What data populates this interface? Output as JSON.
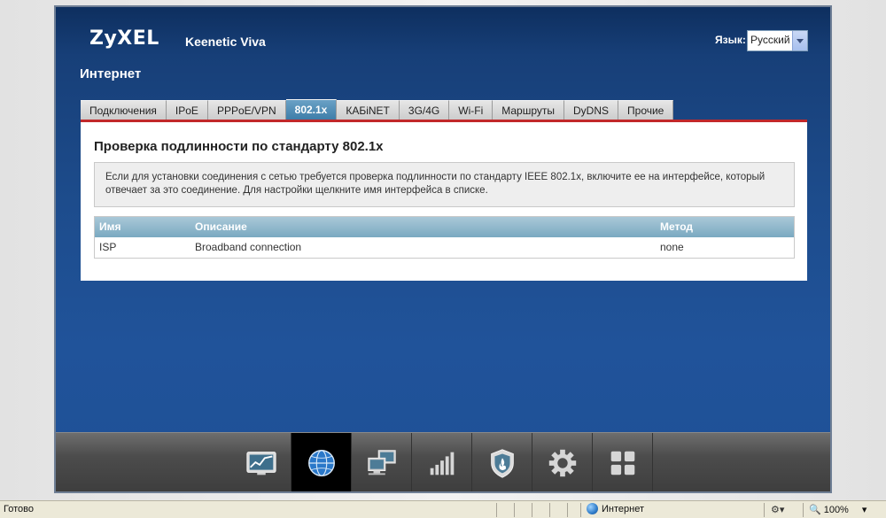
{
  "header": {
    "logo": "ZyXEL",
    "model": "Keenetic Viva",
    "language_label": "Язык:",
    "language_value": "Русский"
  },
  "section_title": "Интернет",
  "tabs": [
    {
      "label": "Подключения",
      "active": false
    },
    {
      "label": "IPoE",
      "active": false
    },
    {
      "label": "PPPoE/VPN",
      "active": false
    },
    {
      "label": "802.1x",
      "active": true
    },
    {
      "label": "КАБiNET",
      "active": false
    },
    {
      "label": "3G/4G",
      "active": false
    },
    {
      "label": "Wi-Fi",
      "active": false
    },
    {
      "label": "Маршруты",
      "active": false
    },
    {
      "label": "DyDNS",
      "active": false
    },
    {
      "label": "Прочие",
      "active": false
    }
  ],
  "content": {
    "heading": "Проверка подлинности по стандарту 802.1x",
    "info": "Если для установки соединения с сетью требуется проверка подлинности по стандарту IEEE 802.1x, включите ее на интерфейсе, который отвечает за это соединение. Для настройки щелкните имя интерфейса в списке.",
    "table": {
      "headers": [
        "Имя",
        "Описание",
        "Метод"
      ],
      "rows": [
        [
          "ISP",
          "Broadband connection",
          "none"
        ]
      ]
    }
  },
  "dock": [
    {
      "icon": "monitor-chart-icon",
      "active": false
    },
    {
      "icon": "globe-icon",
      "active": true
    },
    {
      "icon": "network-computers-icon",
      "active": false
    },
    {
      "icon": "signal-bars-icon",
      "active": false
    },
    {
      "icon": "shield-icon",
      "active": false
    },
    {
      "icon": "gear-icon",
      "active": false
    },
    {
      "icon": "apps-grid-icon",
      "active": false
    }
  ],
  "statusbar": {
    "status": "Готово",
    "zone": "Интернет",
    "zoom": "100%"
  },
  "colors": {
    "accent_red": "#c2282a",
    "active_tab": "#3a7aa6",
    "frame_blue": "#1d4c8c"
  }
}
